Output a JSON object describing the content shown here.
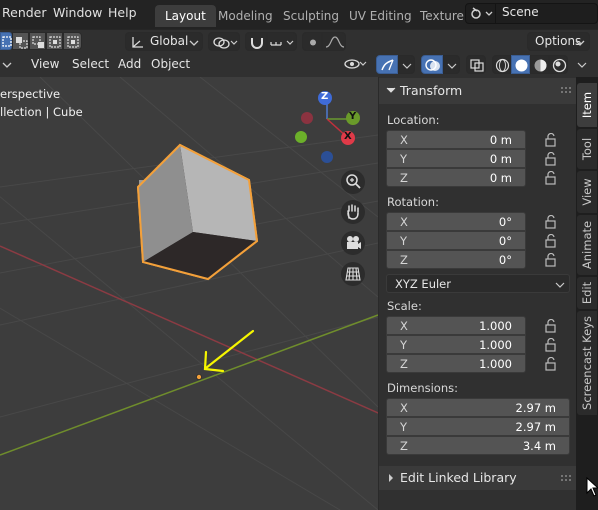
{
  "topbar": {
    "menus": [
      "Render",
      "Window",
      "Help"
    ],
    "workspace_tabs": [
      "Layout",
      "Modeling",
      "Sculpting",
      "UV Editing",
      "Texture"
    ],
    "active_tab": "Layout",
    "scene_name": "Scene"
  },
  "header": {
    "orientation": "Global",
    "options_label": "Options"
  },
  "viewport_header": {
    "menus": [
      "View",
      "Select",
      "Add",
      "Object"
    ]
  },
  "viewport": {
    "view_name": "erspective",
    "collection_info": "llection | Cube",
    "gizmo": {
      "z_label": "Z",
      "y_label": "Y",
      "x_label": "X"
    }
  },
  "npanel": {
    "transform_title": "Transform",
    "location_label": "Location:",
    "location": [
      {
        "axis": "X",
        "value": "0 m"
      },
      {
        "axis": "Y",
        "value": "0 m"
      },
      {
        "axis": "Z",
        "value": "0 m"
      }
    ],
    "rotation_label": "Rotation:",
    "rotation": [
      {
        "axis": "X",
        "value": "0°"
      },
      {
        "axis": "Y",
        "value": "0°"
      },
      {
        "axis": "Z",
        "value": "0°"
      }
    ],
    "rotation_mode": "XYZ Euler",
    "scale_label": "Scale:",
    "scale": [
      {
        "axis": "X",
        "value": "1.000"
      },
      {
        "axis": "Y",
        "value": "1.000"
      },
      {
        "axis": "Z",
        "value": "1.000"
      }
    ],
    "dimensions_label": "Dimensions:",
    "dimensions": [
      {
        "axis": "X",
        "value": "2.97 m"
      },
      {
        "axis": "Y",
        "value": "2.97 m"
      },
      {
        "axis": "Z",
        "value": "3.4 m"
      }
    ],
    "edit_linked_library": "Edit Linked Library"
  },
  "side_tabs": [
    "Item",
    "Tool",
    "View",
    "Animate",
    "Edit",
    "Screencast Keys"
  ],
  "colors": {
    "accent_blue": "#4772b3",
    "selection_orange": "#f3a03a",
    "annotation_yellow": "#f6f600",
    "axis_red": "#8b3b43",
    "axis_green": "#6f8d2c"
  }
}
